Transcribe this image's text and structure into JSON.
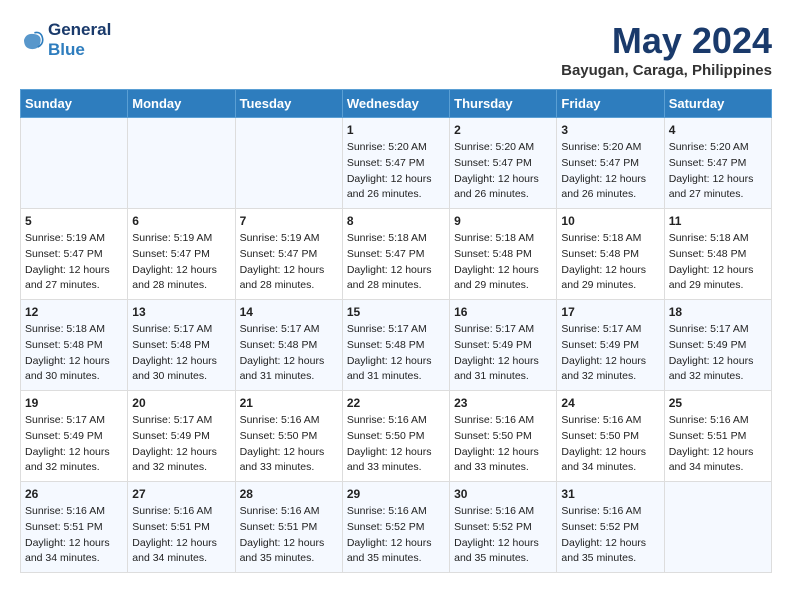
{
  "header": {
    "logo_line1": "General",
    "logo_line2": "Blue",
    "month_title": "May 2024",
    "location": "Bayugan, Caraga, Philippines"
  },
  "days_of_week": [
    "Sunday",
    "Monday",
    "Tuesday",
    "Wednesday",
    "Thursday",
    "Friday",
    "Saturday"
  ],
  "weeks": [
    [
      {
        "day": "",
        "info": ""
      },
      {
        "day": "",
        "info": ""
      },
      {
        "day": "",
        "info": ""
      },
      {
        "day": "1",
        "info": "Sunrise: 5:20 AM\nSunset: 5:47 PM\nDaylight: 12 hours\nand 26 minutes."
      },
      {
        "day": "2",
        "info": "Sunrise: 5:20 AM\nSunset: 5:47 PM\nDaylight: 12 hours\nand 26 minutes."
      },
      {
        "day": "3",
        "info": "Sunrise: 5:20 AM\nSunset: 5:47 PM\nDaylight: 12 hours\nand 26 minutes."
      },
      {
        "day": "4",
        "info": "Sunrise: 5:20 AM\nSunset: 5:47 PM\nDaylight: 12 hours\nand 27 minutes."
      }
    ],
    [
      {
        "day": "5",
        "info": "Sunrise: 5:19 AM\nSunset: 5:47 PM\nDaylight: 12 hours\nand 27 minutes."
      },
      {
        "day": "6",
        "info": "Sunrise: 5:19 AM\nSunset: 5:47 PM\nDaylight: 12 hours\nand 28 minutes."
      },
      {
        "day": "7",
        "info": "Sunrise: 5:19 AM\nSunset: 5:47 PM\nDaylight: 12 hours\nand 28 minutes."
      },
      {
        "day": "8",
        "info": "Sunrise: 5:18 AM\nSunset: 5:47 PM\nDaylight: 12 hours\nand 28 minutes."
      },
      {
        "day": "9",
        "info": "Sunrise: 5:18 AM\nSunset: 5:48 PM\nDaylight: 12 hours\nand 29 minutes."
      },
      {
        "day": "10",
        "info": "Sunrise: 5:18 AM\nSunset: 5:48 PM\nDaylight: 12 hours\nand 29 minutes."
      },
      {
        "day": "11",
        "info": "Sunrise: 5:18 AM\nSunset: 5:48 PM\nDaylight: 12 hours\nand 29 minutes."
      }
    ],
    [
      {
        "day": "12",
        "info": "Sunrise: 5:18 AM\nSunset: 5:48 PM\nDaylight: 12 hours\nand 30 minutes."
      },
      {
        "day": "13",
        "info": "Sunrise: 5:17 AM\nSunset: 5:48 PM\nDaylight: 12 hours\nand 30 minutes."
      },
      {
        "day": "14",
        "info": "Sunrise: 5:17 AM\nSunset: 5:48 PM\nDaylight: 12 hours\nand 31 minutes."
      },
      {
        "day": "15",
        "info": "Sunrise: 5:17 AM\nSunset: 5:48 PM\nDaylight: 12 hours\nand 31 minutes."
      },
      {
        "day": "16",
        "info": "Sunrise: 5:17 AM\nSunset: 5:49 PM\nDaylight: 12 hours\nand 31 minutes."
      },
      {
        "day": "17",
        "info": "Sunrise: 5:17 AM\nSunset: 5:49 PM\nDaylight: 12 hours\nand 32 minutes."
      },
      {
        "day": "18",
        "info": "Sunrise: 5:17 AM\nSunset: 5:49 PM\nDaylight: 12 hours\nand 32 minutes."
      }
    ],
    [
      {
        "day": "19",
        "info": "Sunrise: 5:17 AM\nSunset: 5:49 PM\nDaylight: 12 hours\nand 32 minutes."
      },
      {
        "day": "20",
        "info": "Sunrise: 5:17 AM\nSunset: 5:49 PM\nDaylight: 12 hours\nand 32 minutes."
      },
      {
        "day": "21",
        "info": "Sunrise: 5:16 AM\nSunset: 5:50 PM\nDaylight: 12 hours\nand 33 minutes."
      },
      {
        "day": "22",
        "info": "Sunrise: 5:16 AM\nSunset: 5:50 PM\nDaylight: 12 hours\nand 33 minutes."
      },
      {
        "day": "23",
        "info": "Sunrise: 5:16 AM\nSunset: 5:50 PM\nDaylight: 12 hours\nand 33 minutes."
      },
      {
        "day": "24",
        "info": "Sunrise: 5:16 AM\nSunset: 5:50 PM\nDaylight: 12 hours\nand 34 minutes."
      },
      {
        "day": "25",
        "info": "Sunrise: 5:16 AM\nSunset: 5:51 PM\nDaylight: 12 hours\nand 34 minutes."
      }
    ],
    [
      {
        "day": "26",
        "info": "Sunrise: 5:16 AM\nSunset: 5:51 PM\nDaylight: 12 hours\nand 34 minutes."
      },
      {
        "day": "27",
        "info": "Sunrise: 5:16 AM\nSunset: 5:51 PM\nDaylight: 12 hours\nand 34 minutes."
      },
      {
        "day": "28",
        "info": "Sunrise: 5:16 AM\nSunset: 5:51 PM\nDaylight: 12 hours\nand 35 minutes."
      },
      {
        "day": "29",
        "info": "Sunrise: 5:16 AM\nSunset: 5:52 PM\nDaylight: 12 hours\nand 35 minutes."
      },
      {
        "day": "30",
        "info": "Sunrise: 5:16 AM\nSunset: 5:52 PM\nDaylight: 12 hours\nand 35 minutes."
      },
      {
        "day": "31",
        "info": "Sunrise: 5:16 AM\nSunset: 5:52 PM\nDaylight: 12 hours\nand 35 minutes."
      },
      {
        "day": "",
        "info": ""
      }
    ]
  ]
}
